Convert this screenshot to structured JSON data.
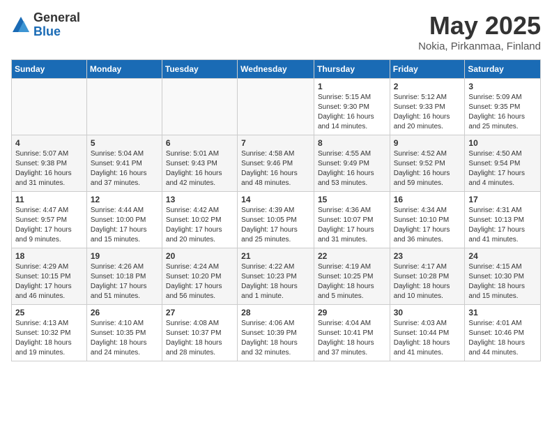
{
  "header": {
    "logo_general": "General",
    "logo_blue": "Blue",
    "month_title": "May 2025",
    "location": "Nokia, Pirkanmaa, Finland"
  },
  "days_of_week": [
    "Sunday",
    "Monday",
    "Tuesday",
    "Wednesday",
    "Thursday",
    "Friday",
    "Saturday"
  ],
  "weeks": [
    [
      {
        "day": "",
        "info": ""
      },
      {
        "day": "",
        "info": ""
      },
      {
        "day": "",
        "info": ""
      },
      {
        "day": "",
        "info": ""
      },
      {
        "day": "1",
        "info": "Sunrise: 5:15 AM\nSunset: 9:30 PM\nDaylight: 16 hours\nand 14 minutes."
      },
      {
        "day": "2",
        "info": "Sunrise: 5:12 AM\nSunset: 9:33 PM\nDaylight: 16 hours\nand 20 minutes."
      },
      {
        "day": "3",
        "info": "Sunrise: 5:09 AM\nSunset: 9:35 PM\nDaylight: 16 hours\nand 25 minutes."
      }
    ],
    [
      {
        "day": "4",
        "info": "Sunrise: 5:07 AM\nSunset: 9:38 PM\nDaylight: 16 hours\nand 31 minutes."
      },
      {
        "day": "5",
        "info": "Sunrise: 5:04 AM\nSunset: 9:41 PM\nDaylight: 16 hours\nand 37 minutes."
      },
      {
        "day": "6",
        "info": "Sunrise: 5:01 AM\nSunset: 9:43 PM\nDaylight: 16 hours\nand 42 minutes."
      },
      {
        "day": "7",
        "info": "Sunrise: 4:58 AM\nSunset: 9:46 PM\nDaylight: 16 hours\nand 48 minutes."
      },
      {
        "day": "8",
        "info": "Sunrise: 4:55 AM\nSunset: 9:49 PM\nDaylight: 16 hours\nand 53 minutes."
      },
      {
        "day": "9",
        "info": "Sunrise: 4:52 AM\nSunset: 9:52 PM\nDaylight: 16 hours\nand 59 minutes."
      },
      {
        "day": "10",
        "info": "Sunrise: 4:50 AM\nSunset: 9:54 PM\nDaylight: 17 hours\nand 4 minutes."
      }
    ],
    [
      {
        "day": "11",
        "info": "Sunrise: 4:47 AM\nSunset: 9:57 PM\nDaylight: 17 hours\nand 9 minutes."
      },
      {
        "day": "12",
        "info": "Sunrise: 4:44 AM\nSunset: 10:00 PM\nDaylight: 17 hours\nand 15 minutes."
      },
      {
        "day": "13",
        "info": "Sunrise: 4:42 AM\nSunset: 10:02 PM\nDaylight: 17 hours\nand 20 minutes."
      },
      {
        "day": "14",
        "info": "Sunrise: 4:39 AM\nSunset: 10:05 PM\nDaylight: 17 hours\nand 25 minutes."
      },
      {
        "day": "15",
        "info": "Sunrise: 4:36 AM\nSunset: 10:07 PM\nDaylight: 17 hours\nand 31 minutes."
      },
      {
        "day": "16",
        "info": "Sunrise: 4:34 AM\nSunset: 10:10 PM\nDaylight: 17 hours\nand 36 minutes."
      },
      {
        "day": "17",
        "info": "Sunrise: 4:31 AM\nSunset: 10:13 PM\nDaylight: 17 hours\nand 41 minutes."
      }
    ],
    [
      {
        "day": "18",
        "info": "Sunrise: 4:29 AM\nSunset: 10:15 PM\nDaylight: 17 hours\nand 46 minutes."
      },
      {
        "day": "19",
        "info": "Sunrise: 4:26 AM\nSunset: 10:18 PM\nDaylight: 17 hours\nand 51 minutes."
      },
      {
        "day": "20",
        "info": "Sunrise: 4:24 AM\nSunset: 10:20 PM\nDaylight: 17 hours\nand 56 minutes."
      },
      {
        "day": "21",
        "info": "Sunrise: 4:22 AM\nSunset: 10:23 PM\nDaylight: 18 hours\nand 1 minute."
      },
      {
        "day": "22",
        "info": "Sunrise: 4:19 AM\nSunset: 10:25 PM\nDaylight: 18 hours\nand 5 minutes."
      },
      {
        "day": "23",
        "info": "Sunrise: 4:17 AM\nSunset: 10:28 PM\nDaylight: 18 hours\nand 10 minutes."
      },
      {
        "day": "24",
        "info": "Sunrise: 4:15 AM\nSunset: 10:30 PM\nDaylight: 18 hours\nand 15 minutes."
      }
    ],
    [
      {
        "day": "25",
        "info": "Sunrise: 4:13 AM\nSunset: 10:32 PM\nDaylight: 18 hours\nand 19 minutes."
      },
      {
        "day": "26",
        "info": "Sunrise: 4:10 AM\nSunset: 10:35 PM\nDaylight: 18 hours\nand 24 minutes."
      },
      {
        "day": "27",
        "info": "Sunrise: 4:08 AM\nSunset: 10:37 PM\nDaylight: 18 hours\nand 28 minutes."
      },
      {
        "day": "28",
        "info": "Sunrise: 4:06 AM\nSunset: 10:39 PM\nDaylight: 18 hours\nand 32 minutes."
      },
      {
        "day": "29",
        "info": "Sunrise: 4:04 AM\nSunset: 10:41 PM\nDaylight: 18 hours\nand 37 minutes."
      },
      {
        "day": "30",
        "info": "Sunrise: 4:03 AM\nSunset: 10:44 PM\nDaylight: 18 hours\nand 41 minutes."
      },
      {
        "day": "31",
        "info": "Sunrise: 4:01 AM\nSunset: 10:46 PM\nDaylight: 18 hours\nand 44 minutes."
      }
    ]
  ]
}
